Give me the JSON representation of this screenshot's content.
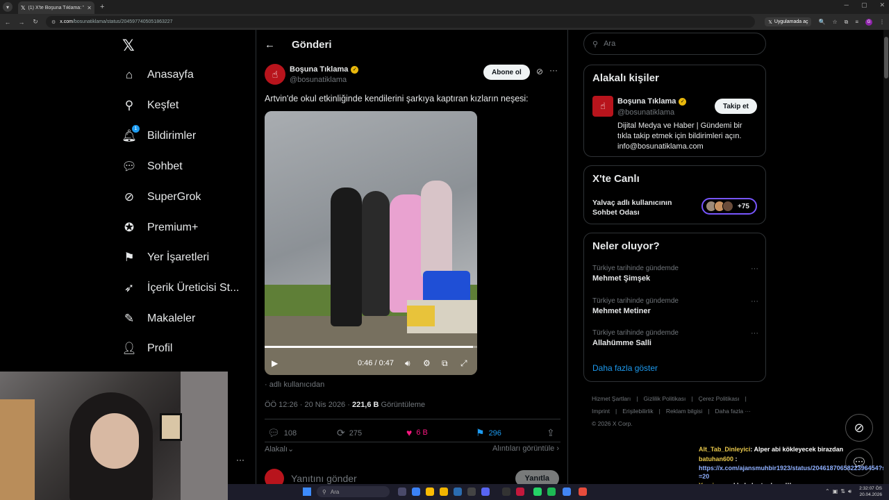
{
  "browser": {
    "tab_title": "(1) X'te Boşuna Tıklama: \"Artvin...",
    "tab_close": "✕",
    "new_tab": "+",
    "url_domain": "x.com",
    "url_path": "/bosunatiklama/status/2045977405051863227",
    "app_button": "Uygulamada aç"
  },
  "nav": {
    "items": [
      {
        "label": "Anasayfa",
        "icon": "home-icon"
      },
      {
        "label": "Keşfet",
        "icon": "search-icon"
      },
      {
        "label": "Bildirimler",
        "icon": "bell-icon",
        "badge": "1"
      },
      {
        "label": "Sohbet",
        "icon": "chat-icon"
      },
      {
        "label": "SuperGrok",
        "icon": "grok-icon"
      },
      {
        "label": "Premium+",
        "icon": "premium-icon"
      },
      {
        "label": "Yer İşaretleri",
        "icon": "bookmark-icon"
      },
      {
        "label": "İçerik Üreticisi St...",
        "icon": "rocket-icon"
      },
      {
        "label": "Makaleler",
        "icon": "article-icon"
      },
      {
        "label": "Profil",
        "icon": "profile-icon"
      }
    ]
  },
  "post": {
    "header_title": "Gönderi",
    "author_name": "Boşuna Tıklama",
    "author_handle": "@bosunatiklama",
    "follow_label": "Abone ol",
    "text": "Artvin'de okul etkinliğinde kendilerini şarkıya kaptıran kızların neşesi:",
    "video_time": "0:46 / 0:47",
    "video_progress": 0.979,
    "caption": "adlı kullanıcıdan",
    "meta_time": "ÖÖ 12:26 · 20 Nis 2026 · ",
    "views": "221,6 B",
    "views_label": " Görüntüleme",
    "replies": "108",
    "reposts": "275",
    "likes": "6 B",
    "bookmarks": "296",
    "related": "Alakalı",
    "quotes": "Alıntıları görüntüle",
    "reply_placeholder": "Yanıtını gönder",
    "reply_button": "Yanıtla"
  },
  "right": {
    "search_placeholder": "Ara",
    "related_title": "Alakalı kişiler",
    "related_name": "Boşuna Tıklama",
    "related_handle": "@bosunatiklama",
    "related_follow": "Takip et",
    "related_bio": "Dijital Medya ve Haber | Gündemi bir tıkla takip etmek için bildirimleri açın. info@bosunatiklama.com",
    "live_title": "X'te Canlı",
    "live_text": "Yalvaç adlı kullanıcının Sohbet Odası",
    "live_count": "+75",
    "trends_title": "Neler oluyor?",
    "trends": [
      {
        "context": "Türkiye tarihinde gündemde",
        "name": "Mehmet Şimşek"
      },
      {
        "context": "Türkiye tarihinde gündemde",
        "name": "Mehmet Metiner"
      },
      {
        "context": "Türkiye tarihinde gündemde",
        "name": "Allahümme Salli"
      }
    ],
    "show_more": "Daha fazla göster",
    "footer": [
      "Hizmet Şartları",
      "|",
      "Gizlilik Politikası",
      "|",
      "Çerez Politikası",
      "|",
      "Imprint",
      "|",
      "Erişilebilirlik",
      "|",
      "Reklam bilgisi",
      "|",
      "Daha fazla ···",
      "© 2026 X Corp."
    ]
  },
  "chat": [
    {
      "user": "Alt_Tab_Dinleyici",
      "msg": ": Alper abi kökleyecek birazdan"
    },
    {
      "user": "batuhan600",
      "msg": " :"
    },
    {
      "link": "https://x.com/ajansmuhbir1923/status/2046187065822396454?s=20"
    },
    {
      "user": "Ymniszm",
      "msg": ": akbabalar toplanın!!!"
    }
  ],
  "taskbar": {
    "search": "Ara",
    "time": "2:32:07 ÖS",
    "date": "20.04.2026"
  },
  "colors": {
    "accent": "#1d9bf0",
    "like": "#f91880",
    "verified": "#e9b80c",
    "brand_red": "#b8141c"
  }
}
